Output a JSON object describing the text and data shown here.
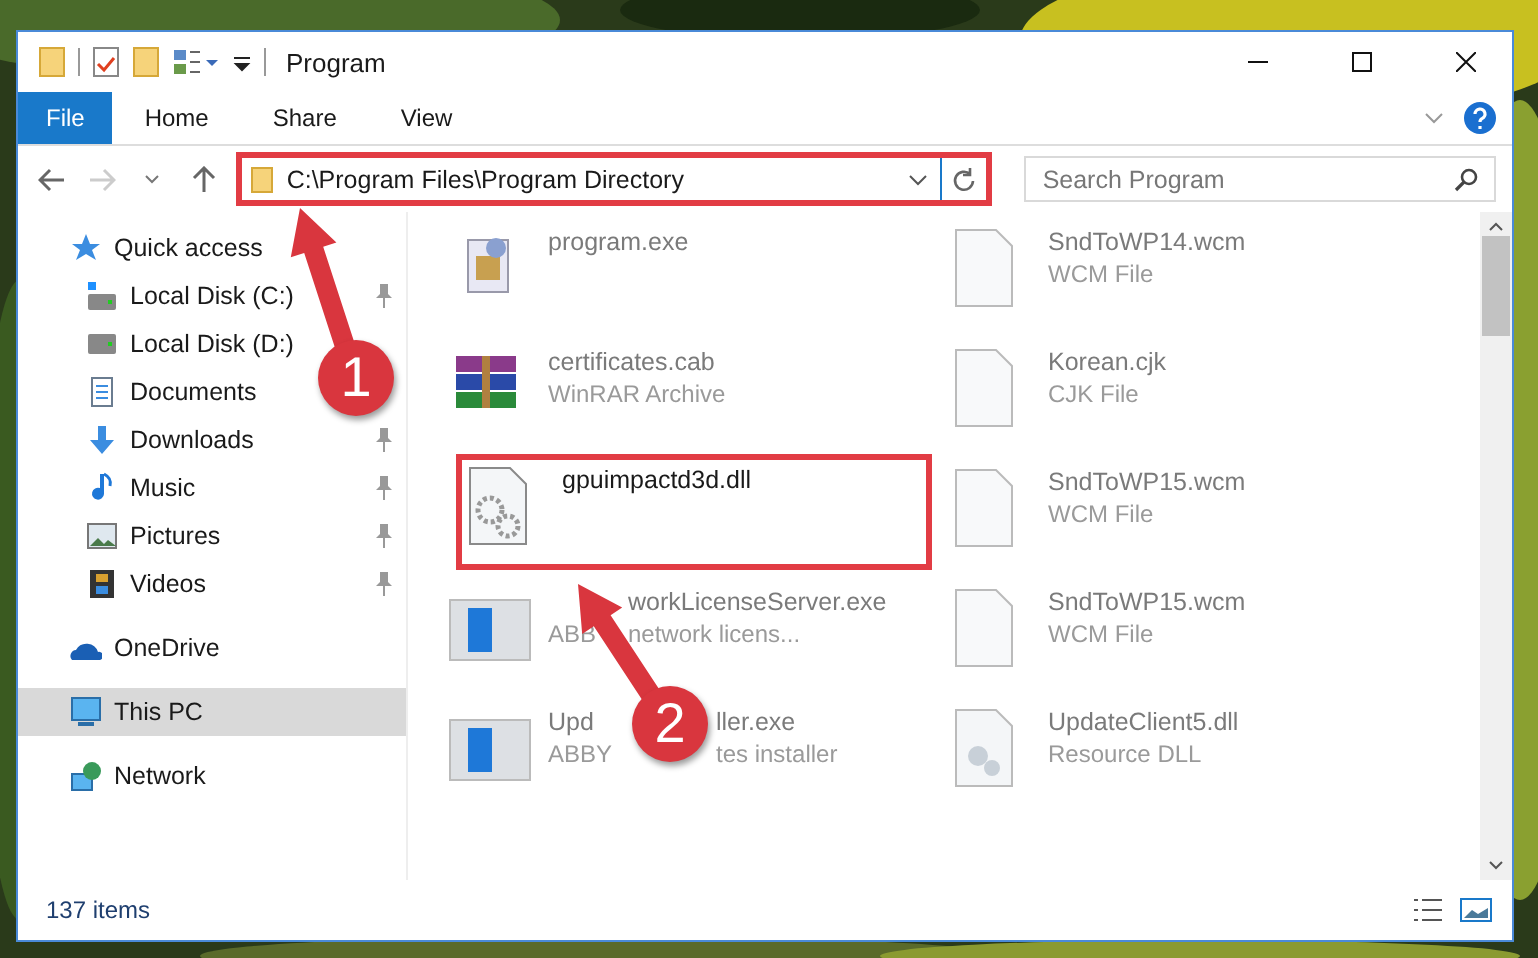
{
  "window": {
    "title": "Program"
  },
  "ribbon_tabs": [
    {
      "label": "File",
      "kind": "menu"
    },
    {
      "label": "Home",
      "kind": "tab"
    },
    {
      "label": "Share",
      "kind": "tab"
    },
    {
      "label": "View",
      "kind": "tab"
    }
  ],
  "address": {
    "path": "C:\\Program Files\\Program Directory",
    "highlighted": true
  },
  "search": {
    "placeholder": "Search Program"
  },
  "sidebar": {
    "items": [
      {
        "label": "Quick access",
        "kind": "star",
        "pinned": false,
        "selected": false,
        "children": [
          {
            "label": "Local Disk (C:)",
            "kind": "drive-c",
            "pinned": true,
            "selected": false
          },
          {
            "label": "Local Disk (D:)",
            "kind": "drive",
            "pinned": false,
            "selected": false
          },
          {
            "label": "Documents",
            "kind": "documents",
            "pinned": false,
            "selected": false
          },
          {
            "label": "Downloads",
            "kind": "downloads",
            "pinned": true,
            "selected": false
          },
          {
            "label": "Music",
            "kind": "music",
            "pinned": true,
            "selected": false
          },
          {
            "label": "Pictures",
            "kind": "pictures",
            "pinned": true,
            "selected": false
          },
          {
            "label": "Videos",
            "kind": "videos",
            "pinned": true,
            "selected": false
          }
        ]
      },
      {
        "label": "OneDrive",
        "kind": "cloud",
        "pinned": false,
        "selected": false
      },
      {
        "label": "This PC",
        "kind": "pc",
        "pinned": false,
        "selected": true
      },
      {
        "label": "Network",
        "kind": "network",
        "pinned": false,
        "selected": false
      }
    ]
  },
  "files": [
    {
      "name_parts": [
        "program.exe"
      ],
      "kind": "installer",
      "highlighted": false
    },
    {
      "name_parts": [
        "certificates.cab"
      ],
      "type_parts": [
        "WinRAR Archive"
      ],
      "kind": "archive",
      "highlighted": false
    },
    {
      "name_parts": [
        "gpuimpactd3d.dll"
      ],
      "kind": "dll",
      "highlighted": true
    },
    {
      "name_parts": [
        "workLicenseServer.exe"
      ],
      "type_parts": [
        "ABB",
        "network licens..."
      ],
      "kind": "app",
      "highlighted": false
    },
    {
      "name_parts": [
        "Upd",
        "ller.exe"
      ],
      "type_parts": [
        "ABBY",
        "tes installer"
      ],
      "kind": "app",
      "highlighted": false
    },
    {
      "name_parts": [
        "SndToWP14.wcm"
      ],
      "type_parts": [
        "WCM File"
      ],
      "kind": "blank",
      "highlighted": false
    },
    {
      "name_parts": [
        "Korean.cjk"
      ],
      "type_parts": [
        "CJK File"
      ],
      "kind": "blank",
      "highlighted": false
    },
    {
      "name_parts": [
        "SndToWP15.wcm"
      ],
      "type_parts": [
        "WCM File"
      ],
      "kind": "blank",
      "highlighted": false
    },
    {
      "name_parts": [
        "SndToWP15.wcm"
      ],
      "type_parts": [
        "WCM File"
      ],
      "kind": "blank",
      "highlighted": false
    },
    {
      "name_parts": [
        "UpdateClient5.dll"
      ],
      "type_parts": [
        "Resource DLL"
      ],
      "kind": "resource",
      "highlighted": false
    }
  ],
  "status_bar": {
    "count": "137 items"
  },
  "annotations": [
    {
      "label": "1"
    },
    {
      "label": "2"
    }
  ]
}
